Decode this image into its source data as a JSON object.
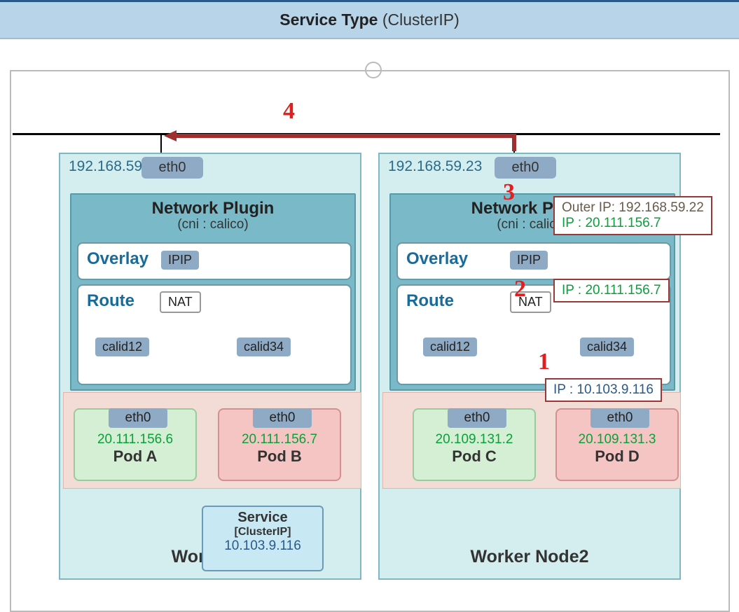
{
  "title": {
    "bold": "Service Type",
    "rest": " (ClusterIP)"
  },
  "node1": {
    "ip": "192.168.59.22",
    "eth0": "eth0",
    "plugin_title": "Network Plugin",
    "plugin_sub": "(cni : calico)",
    "overlay_label": "Overlay",
    "ipip": "IPIP",
    "route_label": "Route",
    "nat": "NAT",
    "calid1": "calid12",
    "calid2": "calid34",
    "podA": {
      "eth0": "eth0",
      "ip": "20.111.156.6",
      "name": "Pod A"
    },
    "podB": {
      "eth0": "eth0",
      "ip": "20.111.156.7",
      "name": "Pod B"
    },
    "title": "Worker N"
  },
  "node2": {
    "ip": "192.168.59.23",
    "eth0": "eth0",
    "plugin_title": "Network Plugin",
    "plugin_sub": "(cni : calico)",
    "overlay_label": "Overlay",
    "ipip": "IPIP",
    "route_label": "Route",
    "nat": "NAT",
    "calid1": "calid12",
    "calid2": "calid34",
    "podC": {
      "eth0": "eth0",
      "ip": "20.109.131.2",
      "name": "Pod C"
    },
    "podD": {
      "eth0": "eth0",
      "ip": "20.109.131.3",
      "name": "Pod D"
    },
    "title": "Worker Node2"
  },
  "service": {
    "l1": "Service",
    "l2": "[ClusterIP]",
    "l3": "10.103.9.116"
  },
  "callout1": {
    "text": "IP : 10.103.9.116"
  },
  "callout2": {
    "text": "IP : 20.111.156.7"
  },
  "callout3": {
    "outer": "Outer IP: 192.168.59.22",
    "ip": "IP : 20.111.156.7"
  },
  "nums": {
    "n1": "1",
    "n2": "2",
    "n3": "3",
    "n4": "4"
  }
}
